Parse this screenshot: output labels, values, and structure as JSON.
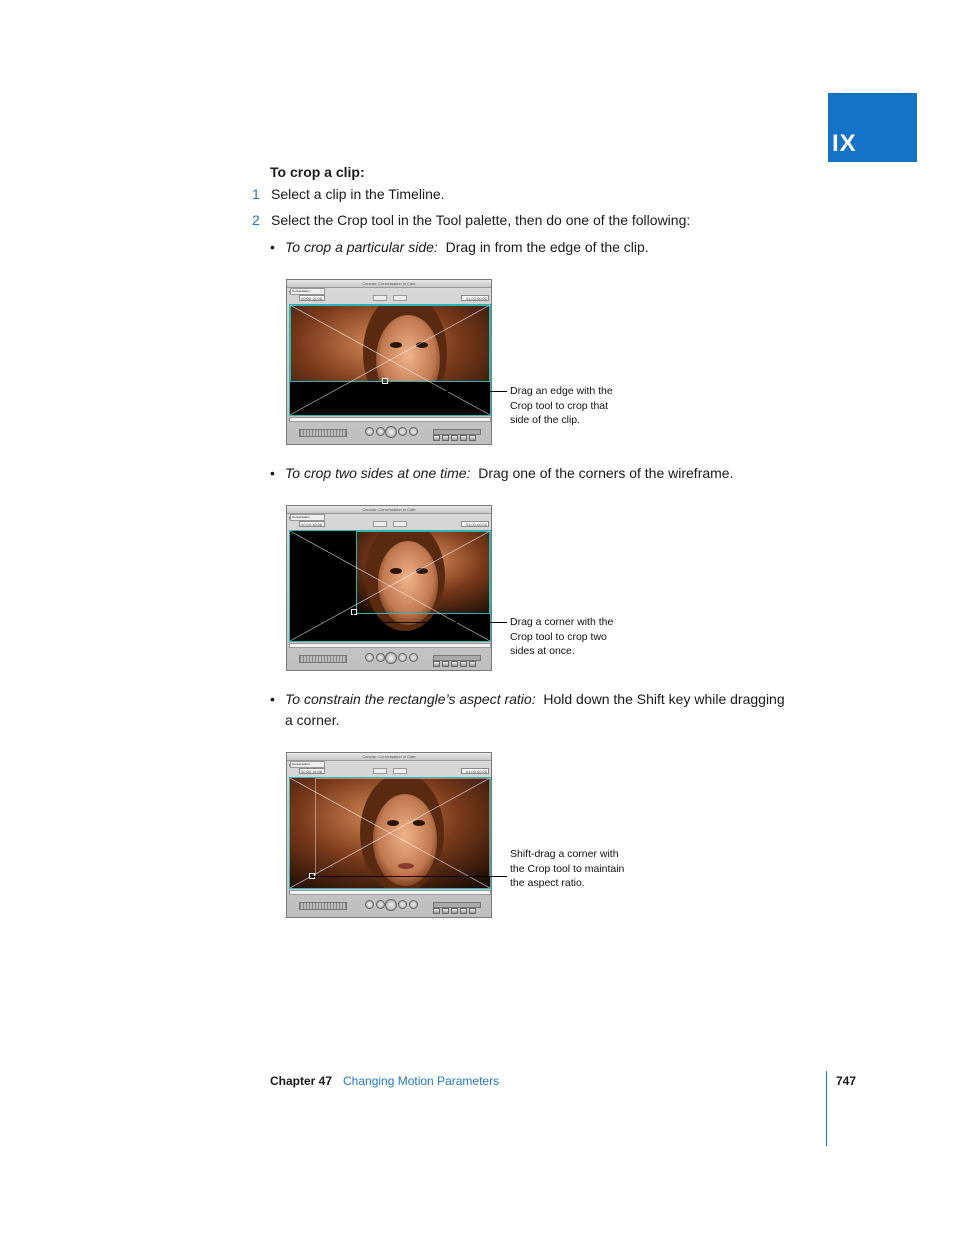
{
  "section_tab": {
    "label": "IX"
  },
  "heading": "To crop a clip:",
  "steps": [
    {
      "num": "1",
      "text": "Select a clip in the Timeline."
    },
    {
      "num": "2",
      "text": "Select the Crop tool in the Tool palette, then do one of the following:"
    }
  ],
  "bullets": [
    {
      "bullet": "•",
      "lead": "To crop a particular side:",
      "text": "Drag in from the edge of the clip."
    },
    {
      "bullet": "•",
      "lead": "To crop two sides at one time:",
      "text": "Drag one of the corners of the wireframe."
    },
    {
      "bullet": "•",
      "lead": "To constrain the rectangle’s aspect ratio:",
      "text": "Hold down the Shift key while dragging a corner."
    }
  ],
  "canvas_window": {
    "title": "Canvas: Conversation in Cafe",
    "tab_label": "Conversation",
    "timecode_left": "00:00:16:08",
    "timecode_right": "01:00:00:00"
  },
  "callouts": [
    {
      "lines": [
        "Drag an edge with the",
        "Crop tool to crop that",
        "side of the clip."
      ]
    },
    {
      "lines": [
        "Drag a corner with the",
        "Crop tool to crop two",
        "sides at once."
      ]
    },
    {
      "lines": [
        "Shift-drag a corner with",
        "the Crop tool to maintain",
        "the aspect ratio."
      ]
    }
  ],
  "footer": {
    "chapter": "Chapter 47",
    "title": "Changing Motion Parameters",
    "page": "747"
  },
  "colors": {
    "accent_blue": "#1473c7",
    "link_blue": "#1f78c8",
    "canvas_border": "#2fb3b3"
  }
}
